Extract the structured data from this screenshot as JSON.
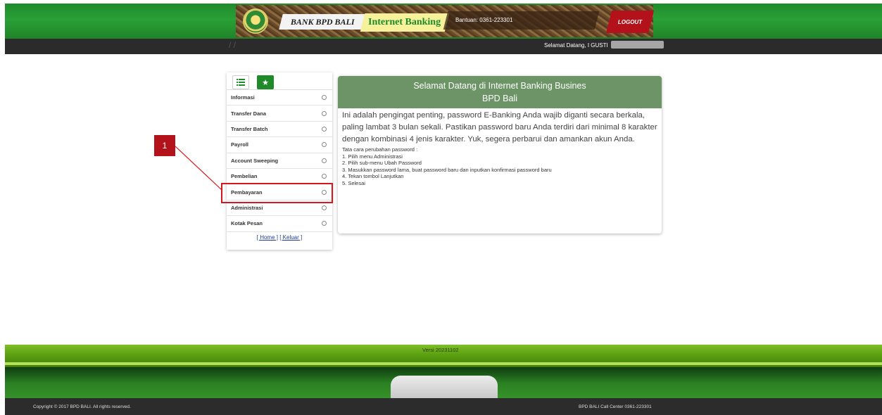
{
  "header": {
    "bank_name": "BANK BPD BALI",
    "app_name": "Internet Banking",
    "help_text": "Bantuan: 0361-223301",
    "logout_label": "LOGOUT"
  },
  "welcome_bar": {
    "greeting": "Selamat Datang, I GUSTI"
  },
  "menu": {
    "tabs": [
      {
        "icon": "list-icon"
      },
      {
        "icon": "star-icon"
      }
    ],
    "items": [
      {
        "label": "Informasi"
      },
      {
        "label": "Transfer Dana"
      },
      {
        "label": "Transfer Batch"
      },
      {
        "label": "Payroll"
      },
      {
        "label": "Account Sweeping"
      },
      {
        "label": "Pembelian"
      },
      {
        "label": "Pembayaran"
      },
      {
        "label": "Administrasi"
      },
      {
        "label": "Kotak Pesan"
      }
    ],
    "home_link": "[ Home ]",
    "logout_link": "[ Keluar ]"
  },
  "callout": {
    "number": "1"
  },
  "card": {
    "title_line1": "Selamat Datang di Internet Banking Busines",
    "title_line2": "BPD Bali",
    "lead": "Ini adalah pengingat penting, password E-Banking Anda wajib diganti secara berkala, paling lambat 3 bulan sekali. Pastikan password baru Anda terdiri dari minimal 8 karakter dengan kombinasi 4 jenis karakter. Yuk, segera perbarui dan amankan akun Anda.",
    "steps_title": "Tata cara perubahan password :",
    "steps": [
      "1. Pilih menu Administrasi",
      "2. Pilih sub-menu Ubah Password",
      "3. Masukkan password lama, buat password baru dan inputkan konfirmasi password baru",
      "4. Tekan tombol Lanjutkan",
      "5. Selesai"
    ]
  },
  "footer": {
    "version": "Versi 20231102",
    "copyright": "Copyright © 2017 BPD BALI. All rights reserved.",
    "call_center": "BPD BALI Call Center 0361-223301"
  },
  "colors": {
    "brand_green": "#1f8a2a",
    "logout_red": "#b3121b",
    "card_header": "#6c9466",
    "callout_red": "#d9161d"
  }
}
